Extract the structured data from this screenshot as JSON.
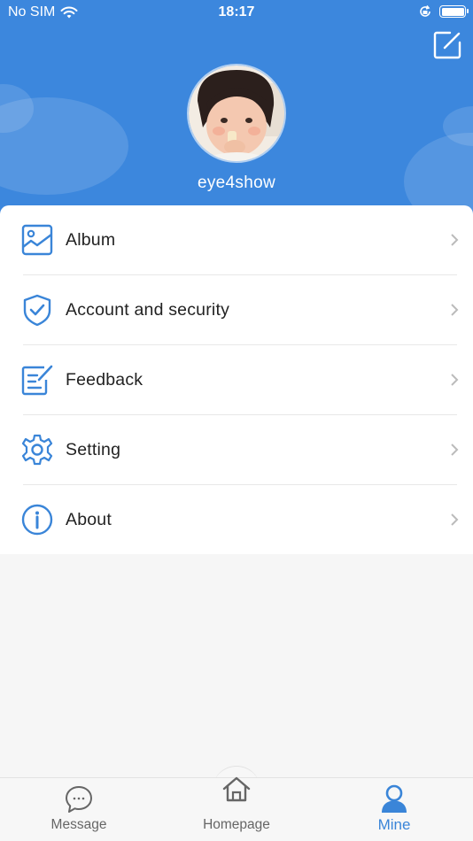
{
  "status_bar": {
    "carrier": "No SIM",
    "time": "18:17"
  },
  "profile": {
    "username": "eye4show"
  },
  "menu": {
    "items": [
      {
        "label": "Album",
        "icon": "album-icon"
      },
      {
        "label": "Account and security",
        "icon": "shield-check-icon"
      },
      {
        "label": "Feedback",
        "icon": "feedback-icon"
      },
      {
        "label": "Setting",
        "icon": "gear-icon"
      },
      {
        "label": "About",
        "icon": "info-icon"
      }
    ]
  },
  "tabbar": {
    "tabs": [
      {
        "label": "Message",
        "icon": "chat-bubble-icon",
        "active": false
      },
      {
        "label": "Homepage",
        "icon": "home-icon",
        "active": false
      },
      {
        "label": "Mine",
        "icon": "person-icon",
        "active": true
      }
    ]
  },
  "colors": {
    "primary": "#3c87dd",
    "icon_blue": "#3a85d8",
    "inactive": "#666666",
    "background": "#f6f6f6"
  }
}
